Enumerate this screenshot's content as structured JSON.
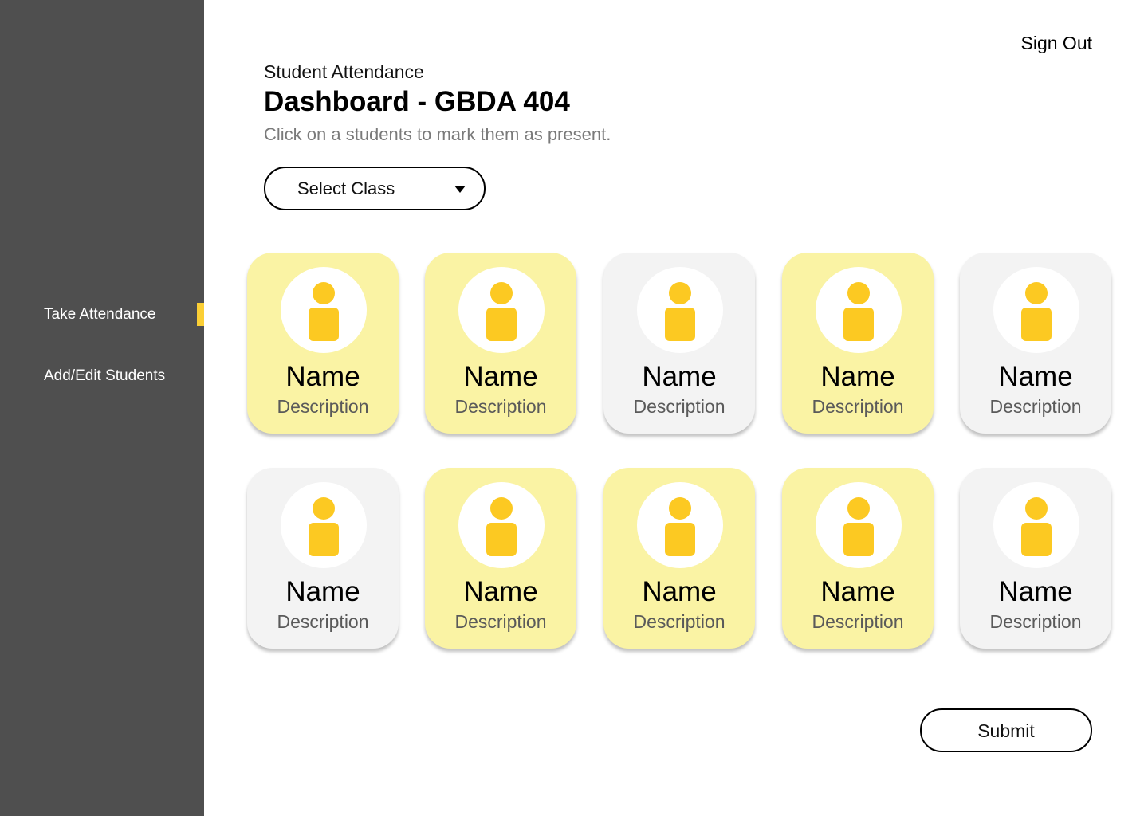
{
  "sidebar": {
    "items": [
      {
        "label": "Take Attendance",
        "active": true
      },
      {
        "label": "Add/Edit Students",
        "active": false
      }
    ],
    "accent_color": "#fbcf35",
    "background_color": "#4f4f4f"
  },
  "header": {
    "sign_out_label": "Sign Out",
    "eyebrow": "Student Attendance",
    "title": "Dashboard - GBDA 404",
    "subtitle": "Click on a students to mark them as present."
  },
  "class_select": {
    "label": "Select Class",
    "icon": "caret-down-icon"
  },
  "students": [
    {
      "name": "Name",
      "description": "Description",
      "present": true
    },
    {
      "name": "Name",
      "description": "Description",
      "present": true
    },
    {
      "name": "Name",
      "description": "Description",
      "present": false
    },
    {
      "name": "Name",
      "description": "Description",
      "present": true
    },
    {
      "name": "Name",
      "description": "Description",
      "present": false
    },
    {
      "name": "Name",
      "description": "Description",
      "present": false
    },
    {
      "name": "Name",
      "description": "Description",
      "present": true
    },
    {
      "name": "Name",
      "description": "Description",
      "present": true
    },
    {
      "name": "Name",
      "description": "Description",
      "present": true
    },
    {
      "name": "Name",
      "description": "Description",
      "present": false
    }
  ],
  "colors": {
    "present_card": "#faf3a4",
    "absent_card": "#f3f3f3",
    "avatar_icon": "#fcc922"
  },
  "avatar_icon": "person-icon",
  "submit_label": "Submit"
}
